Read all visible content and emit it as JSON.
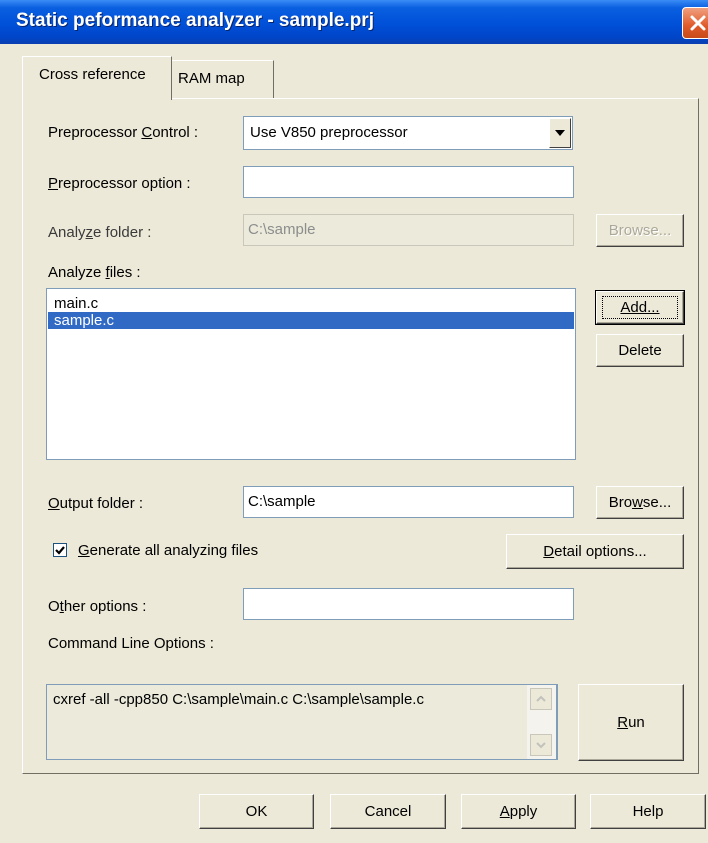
{
  "window": {
    "title": "Static peformance analyzer - sample.prj"
  },
  "tabs": [
    {
      "label": "Cross reference",
      "active": true
    },
    {
      "label": "RAM map",
      "active": false
    }
  ],
  "form": {
    "preprocessor_control": {
      "label_pre": "Preprocessor ",
      "label_key": "C",
      "label_post": "ontrol :",
      "value": "Use V850 preprocessor"
    },
    "preprocessor_option": {
      "label_key": "P",
      "label_post": "reprocessor option :",
      "value": ""
    },
    "analyze_folder": {
      "label_pre": "Analy",
      "label_key": "z",
      "label_post": "e folder :",
      "value": "C:\\sample",
      "browse_label": "Browse..."
    },
    "analyze_files": {
      "label_pre": "Analyze ",
      "label_key": "f",
      "label_post": "iles :",
      "items": [
        "main.c",
        "sample.c"
      ],
      "selected_index": 1,
      "add_label": "Add...",
      "delete_label": "Delete"
    },
    "output_folder": {
      "label_key": "O",
      "label_post": "utput folder :",
      "value": "C:\\sample",
      "browse_pre": "Bro",
      "browse_key": "w",
      "browse_post": "se..."
    },
    "generate_all": {
      "checked": true,
      "label_key": "G",
      "label_post": "enerate all analyzing files"
    },
    "detail_options": {
      "label_key": "D",
      "label_post": "etail options..."
    },
    "other_options": {
      "label_pre": "O",
      "label_key": "t",
      "label_post": "her options :",
      "value": ""
    },
    "command_line": {
      "label": "Command Line Options :",
      "value": "cxref -all -cpp850  C:\\sample\\main.c C:\\sample\\sample.c",
      "run_key": "R",
      "run_post": "un"
    }
  },
  "buttons": {
    "ok": "OK",
    "cancel": "Cancel",
    "apply_key": "A",
    "apply_post": "pply",
    "help": "Help"
  }
}
